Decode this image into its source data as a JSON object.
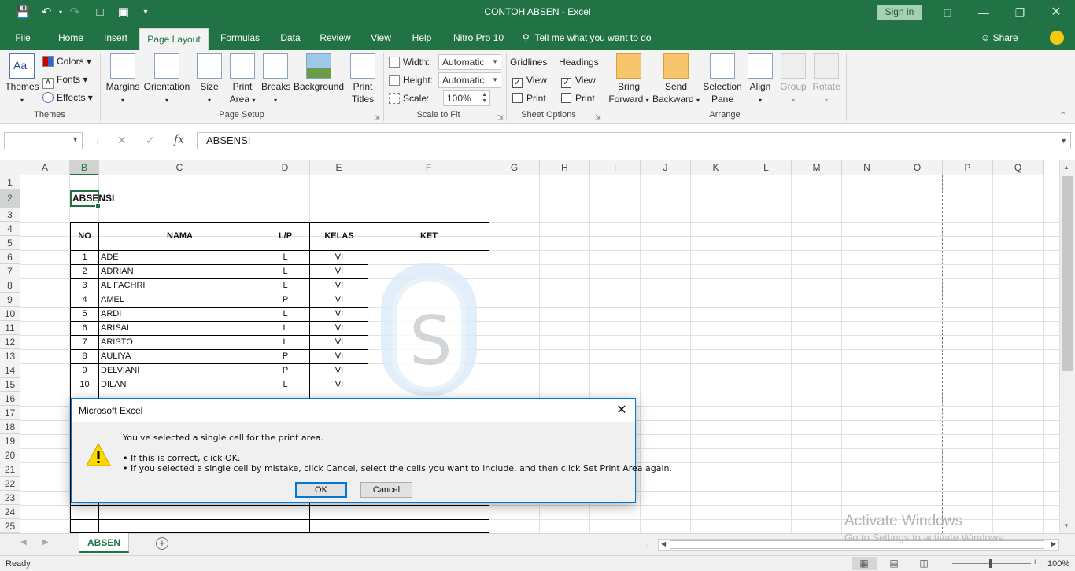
{
  "window": {
    "title": "CONTOH ABSEN  -  Excel",
    "signin": "Sign in"
  },
  "tabs": [
    {
      "label": "File"
    },
    {
      "label": "Home"
    },
    {
      "label": "Insert"
    },
    {
      "label": "Page Layout"
    },
    {
      "label": "Formulas"
    },
    {
      "label": "Data"
    },
    {
      "label": "Review"
    },
    {
      "label": "View"
    },
    {
      "label": "Help"
    },
    {
      "label": "Nitro Pro 10"
    }
  ],
  "tell_me": "Tell me what you want to do",
  "share": "Share",
  "ribbon": {
    "themes": {
      "label": "Themes",
      "colors": "Colors",
      "fonts": "Fonts",
      "effects": "Effects",
      "group": "Themes"
    },
    "page_setup": {
      "margins": "Margins",
      "orientation": "Orientation",
      "size": "Size",
      "print_area_1": "Print",
      "print_area_2": "Area",
      "breaks": "Breaks",
      "background": "Background",
      "print_titles_1": "Print",
      "print_titles_2": "Titles",
      "group": "Page Setup"
    },
    "scale": {
      "width_label": "Width:",
      "width_value": "Automatic",
      "height_label": "Height:",
      "height_value": "Automatic",
      "scale_label": "Scale:",
      "scale_value": "100%",
      "group": "Scale to Fit"
    },
    "sheet_options": {
      "gridlines": "Gridlines",
      "headings": "Headings",
      "view": "View",
      "print": "Print",
      "group": "Sheet Options"
    },
    "arrange": {
      "bring_1": "Bring",
      "bring_2": "Forward",
      "send_1": "Send",
      "send_2": "Backward",
      "sel_1": "Selection",
      "sel_2": "Pane",
      "align": "Align",
      "group_btn": "Group",
      "rotate": "Rotate",
      "group": "Arrange"
    }
  },
  "formula_bar": {
    "name_box": "",
    "formula": "ABSENSI",
    "fx": "fx"
  },
  "columns": [
    "A",
    "B",
    "C",
    "D",
    "E",
    "F",
    "G",
    "H",
    "I",
    "J",
    "K",
    "L",
    "M",
    "N",
    "O",
    "P",
    "Q"
  ],
  "rows": [
    "1",
    "2",
    "3",
    "4",
    "5",
    "6",
    "7",
    "8",
    "9",
    "10",
    "11",
    "12",
    "13",
    "14",
    "15",
    "16",
    "17",
    "18",
    "19",
    "20",
    "21",
    "22",
    "23",
    "24",
    "25"
  ],
  "sheet": {
    "title": "ABSENSI",
    "headers": {
      "no": "NO",
      "nama": "NAMA",
      "lp": "L/P",
      "kelas": "KELAS",
      "ket": "KET"
    },
    "students": [
      {
        "no": "1",
        "nama": "ADE",
        "lp": "L",
        "kelas": "VI"
      },
      {
        "no": "2",
        "nama": "ADRIAN",
        "lp": "L",
        "kelas": "VI"
      },
      {
        "no": "3",
        "nama": "AL FACHRI",
        "lp": "L",
        "kelas": "VI"
      },
      {
        "no": "4",
        "nama": "AMEL",
        "lp": "P",
        "kelas": "VI"
      },
      {
        "no": "5",
        "nama": "ARDI",
        "lp": "L",
        "kelas": "VI"
      },
      {
        "no": "6",
        "nama": "ARISAL",
        "lp": "L",
        "kelas": "VI"
      },
      {
        "no": "7",
        "nama": "ARISTO",
        "lp": "L",
        "kelas": "VI"
      },
      {
        "no": "8",
        "nama": "AULIYA",
        "lp": "P",
        "kelas": "VI"
      },
      {
        "no": "9",
        "nama": "DELVIANI",
        "lp": "P",
        "kelas": "VI"
      },
      {
        "no": "10",
        "nama": "DILAN",
        "lp": "L",
        "kelas": "VI"
      }
    ]
  },
  "sheet_tab": "ABSEN",
  "status": {
    "ready": "Ready",
    "zoom": "100%"
  },
  "activate": {
    "line1": "Activate Windows",
    "line2": "Go to Settings to activate Windows."
  },
  "dialog": {
    "title": "Microsoft Excel",
    "line1": "You've selected a single cell for the print area.",
    "line2": "• If this is correct, click OK.",
    "line3": "• If you selected a single cell by mistake, click Cancel, select the cells you want to include, and then click Set Print Area again.",
    "ok": "OK",
    "cancel": "Cancel"
  },
  "colors": {
    "excel_green": "#217346",
    "dialog_border": "#0078d7"
  }
}
